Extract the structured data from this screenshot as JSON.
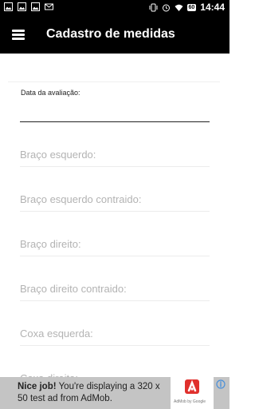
{
  "status_bar": {
    "time": "14:44",
    "battery": "60",
    "left_icons": [
      "image-icon",
      "image-icon",
      "image-icon",
      "mail-icon"
    ],
    "right_icons": [
      "vibrate-icon",
      "alarm-icon",
      "wifi-icon",
      "battery-icon"
    ]
  },
  "app_bar": {
    "title": "Cadastro de medidas",
    "menu_icon": "hamburger-icon"
  },
  "form": {
    "date_label": "Data da avaliação:",
    "date_value": "",
    "fields": [
      {
        "placeholder": "Braço esquerdo:",
        "value": ""
      },
      {
        "placeholder": "Braço esquerdo contraido:",
        "value": ""
      },
      {
        "placeholder": "Braço direito:",
        "value": ""
      },
      {
        "placeholder": "Braço direito contraido:",
        "value": ""
      },
      {
        "placeholder": "Coxa esquerda:",
        "value": ""
      },
      {
        "placeholder": "Coxa direita:",
        "value": ""
      }
    ]
  },
  "ad": {
    "headline": "Nice job!",
    "message": "You're displaying a 320 x 50 test ad from AdMob.",
    "brand": "AdMob by Google",
    "colors": {
      "background": "#c4c4c4",
      "logo": "#e0302d"
    }
  }
}
